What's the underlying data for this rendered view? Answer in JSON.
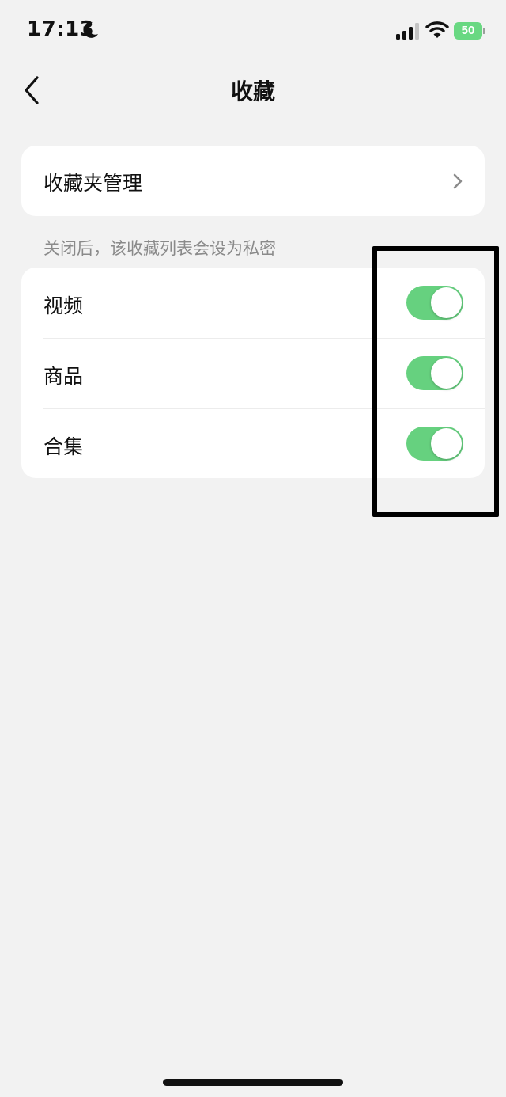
{
  "status_bar": {
    "time": "17:13",
    "battery_level": "50",
    "battery_color": "#69d882"
  },
  "header": {
    "title": "收藏",
    "back_icon": "chevron-left-icon"
  },
  "folders_entry": {
    "label": "收藏夹管理",
    "icon": "chevron-right-icon"
  },
  "privacy_note": "关闭后，该收藏列表会设为私密",
  "toggles": [
    {
      "label": "视频",
      "on": true
    },
    {
      "label": "商品",
      "on": true
    },
    {
      "label": "合集",
      "on": true
    }
  ],
  "colors": {
    "switch_on": "#66d17f",
    "background": "#f2f2f2",
    "card": "#ffffff"
  }
}
